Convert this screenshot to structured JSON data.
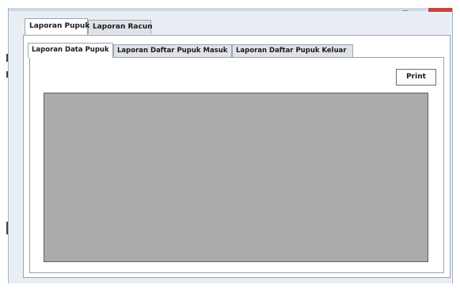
{
  "outer_tabs": [
    {
      "label": "Laporan Pupuk",
      "active": true
    },
    {
      "label": "Laporan Racun",
      "active": false
    }
  ],
  "inner_tabs": [
    {
      "label": "Laporan Data Pupuk",
      "active": true
    },
    {
      "label": "Laporan Daftar Pupuk Masuk",
      "active": false
    },
    {
      "label": "Laporan Daftar Pupuk Keluar",
      "active": false
    }
  ],
  "print_button": {
    "label": "Print"
  },
  "colors": {
    "window_background": "#e9eef5",
    "report_viewer_background": "#ababab",
    "close_button": "#c9463a"
  }
}
